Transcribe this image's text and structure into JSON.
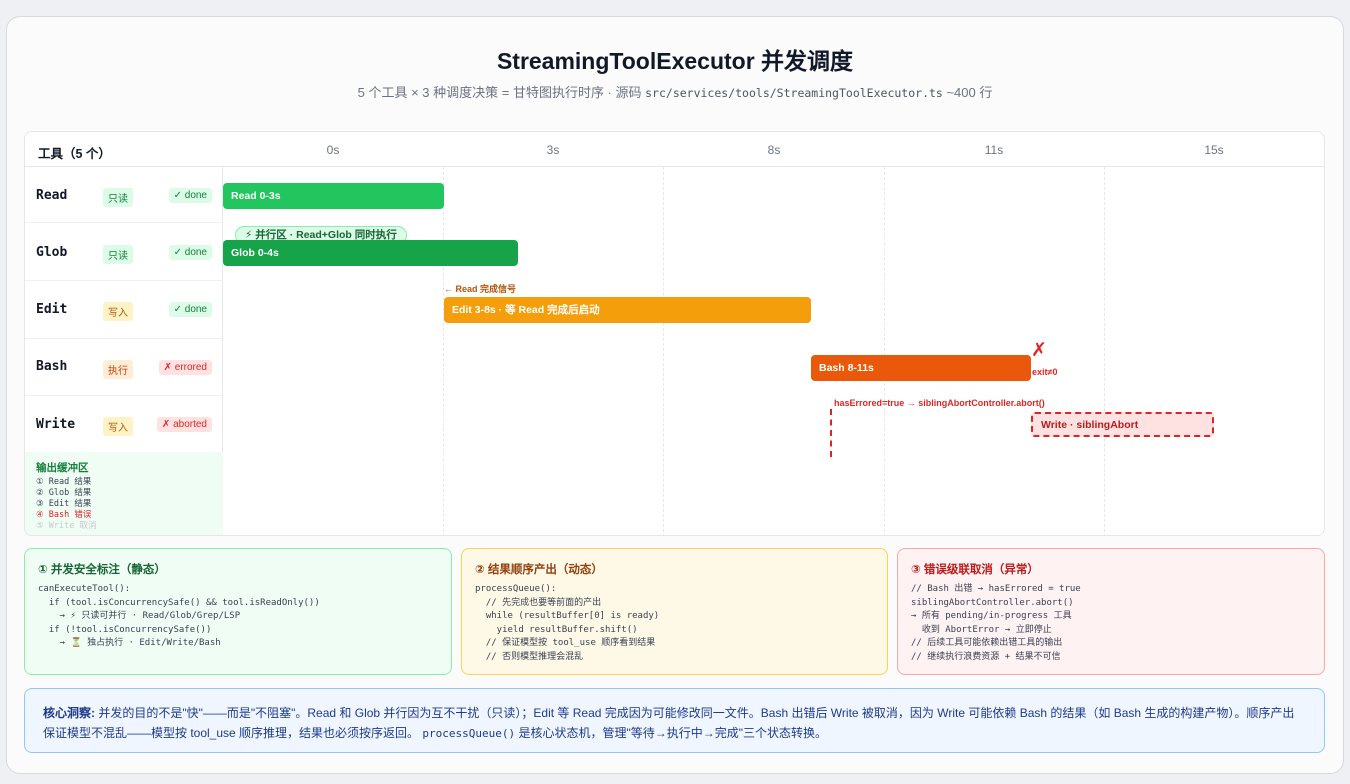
{
  "title": "StreamingToolExecutor 并发调度",
  "subtitle": {
    "text": "5 个工具 × 3 种调度决策 = 甘特图执行时序 · 源码",
    "path": "src/services/tools/StreamingToolExecutor.ts",
    "suffix": "~400 行"
  },
  "gantt": {
    "header_left": "工具（5 个）",
    "ticks": [
      "0s",
      "3s",
      "8s",
      "11s",
      "15s"
    ],
    "rows": [
      {
        "name": "Read",
        "tag": "只读",
        "status": "✓ done"
      },
      {
        "name": "Glob",
        "tag": "只读",
        "status": "✓ done"
      },
      {
        "name": "Edit",
        "tag": "写入",
        "status": "✓ done"
      },
      {
        "name": "Bash",
        "tag": "执行",
        "status": "✗ errored"
      },
      {
        "name": "Write",
        "tag": "写入",
        "status": "✗ aborted"
      }
    ],
    "buffer": {
      "title": "输出缓冲区",
      "lines": [
        "① Read 结果",
        "② Glob 结果",
        "③ Edit 结果",
        "④ Bash 错误",
        "⑤ Write 取消"
      ]
    },
    "bars": {
      "read": "Read 0-3s",
      "glob": "Glob 0-4s",
      "edit": "Edit 3-8s · 等 Read 完成后启动",
      "bash": "Bash 8-11s",
      "write": "Write · siblingAbort"
    },
    "parallel_pill": "⚡ 并行区 · Read+Glob 同时执行",
    "read_signal": "← Read 完成信号",
    "cross_mark": "✗",
    "exit_label": "exit≠0",
    "abort_label": "hasErrored=true → siblingAbortController.abort()"
  },
  "panels": [
    {
      "title": "① 并发安全标注（静态）",
      "code": "canExecuteTool():\n  if (tool.isConcurrencySafe() && tool.isReadOnly())\n    → ⚡ 只读可并行 · Read/Glob/Grep/LSP\n  if (!tool.isConcurrencySafe())\n    → ⏳ 独占执行 · Edit/Write/Bash"
    },
    {
      "title": "② 结果顺序产出（动态）",
      "code": "processQueue():\n  // 先完成也要等前面的产出\n  while (resultBuffer[0] is ready)\n    yield resultBuffer.shift()\n  // 保证模型按 tool_use 顺序看到结果\n  // 否则模型推理会混乱"
    },
    {
      "title": "③ 错误级联取消（异常）",
      "code": "// Bash 出错 → hasErrored = true\nsiblingAbortController.abort()\n→ 所有 pending/in-progress 工具\n  收到 AbortError → 立即停止\n// 后续工具可能依赖出错工具的输出\n// 继续执行浪费资源 + 结果不可信"
    }
  ],
  "insight": {
    "label": "核心洞察:",
    "text1": "并发的目的不是\"快\"——而是\"不阻塞\"。Read 和 Glob 并行因为互不干扰（只读）；Edit 等 Read 完成因为可能修改同一文件。Bash 出错后 Write 被取消，因为 Write 可能依赖 Bash 的结果（如 Bash 生成的构建产物）。顺序产出保证模型不混乱——模型按 tool_use 顺序推理，结果也必须按序返回。",
    "code": "processQueue()",
    "text2": "是核心状态机，管理\"等待→执行中→完成\"三个状态转换。"
  },
  "colors": {
    "read": "#22c55e",
    "glob": "#16a34a",
    "edit": "#f59e0b",
    "bash": "#ea580c",
    "write_fill": "#fee2e2",
    "write_border": "#dc2626"
  }
}
